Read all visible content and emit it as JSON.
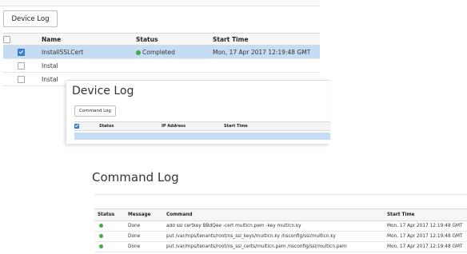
{
  "jobs_panel": {
    "button_label": "Device Log",
    "columns": [
      "",
      "Name",
      "Status",
      "Start Time"
    ],
    "rows": [
      {
        "selected": true,
        "name": "InstallSSLCert",
        "status": "Completed",
        "start_time": "Mon, 17 Apr 2017 12:19:48 GMT"
      },
      {
        "selected": false,
        "name": "Instal",
        "status": "",
        "start_time": ""
      },
      {
        "selected": false,
        "name": "Instal",
        "status": "",
        "start_time": ""
      }
    ],
    "status_color": "#3fae49",
    "selected_row_color": "#c6dcf3"
  },
  "device_log": {
    "title": "Device Log",
    "button_label": "Command Log",
    "columns": [
      "",
      "Status",
      "IP Address",
      "Start Time"
    ]
  },
  "command_log": {
    "title": "Command Log",
    "columns": [
      "Status",
      "Message",
      "Command",
      "Start Time"
    ],
    "rows": [
      {
        "message": "Done",
        "command": "add ssl certkey BBdQee -cert multicn.pem -key multicn.ky",
        "start_time": "Mon, 17 Apr 2017 12:19:48 GMT"
      },
      {
        "message": "Done",
        "command": "put /var/mps/tenants/root/ns_ssl_keys/multicn.ky /nsconfig/ssl/multicn.ky",
        "start_time": "Mon, 17 Apr 2017 12:19:48 GMT"
      },
      {
        "message": "Done",
        "command": "put /var/mps/tenants/root/ns_ssl_certs/multicn.pem /nsconfig/ssl/multicn.pem",
        "start_time": "Mon, 17 Apr 2017 12:19:48 GMT"
      }
    ]
  }
}
